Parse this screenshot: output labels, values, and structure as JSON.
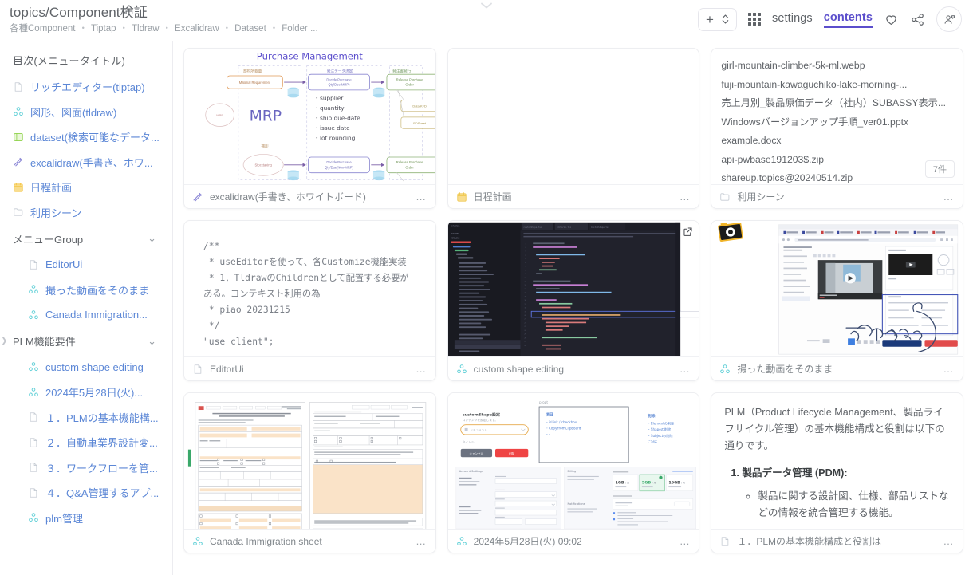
{
  "header": {
    "title": "topics/Component検証",
    "breadcrumb": [
      "各種Component",
      "Tiptap",
      "Tldraw",
      "Excalidraw",
      "Dataset",
      "Folder ..."
    ],
    "add_label": "+",
    "grid_icon": "grid-icon",
    "nav": [
      {
        "label": "settings",
        "active": false
      },
      {
        "label": "contents",
        "active": true
      }
    ],
    "favorite_icon": "heart-icon",
    "share_icon": "share-icon",
    "account_icon": "account-icon",
    "accent_color": "#5b4ecc"
  },
  "sidebar": {
    "title": "目次(メニュータイトル)",
    "items": [
      {
        "label": "リッチエディター(tiptap)",
        "icon": "document-icon",
        "icon_color": "#c5cbd3"
      },
      {
        "label": "図形、図面(tldraw)",
        "icon": "tldraw-icon",
        "icon_color": "#5ecfd6"
      },
      {
        "label": "dataset(検索可能なデータ...",
        "icon": "dataset-icon",
        "icon_color": "#8ed24a"
      },
      {
        "label": "excalidraw(手書き、ホワ...",
        "icon": "excalidraw-icon",
        "icon_color": "#8b87d6"
      },
      {
        "label": "日程計画",
        "icon": "calendar-icon",
        "icon_color": "#f5c84c"
      },
      {
        "label": "利用シーン",
        "icon": "folder-icon",
        "icon_color": "#c5cbd3"
      }
    ],
    "groups": [
      {
        "label": "メニューGroup",
        "expanded": true,
        "children": [
          {
            "label": "EditorUi",
            "icon": "document-icon",
            "icon_color": "#c5cbd3"
          },
          {
            "label": "撮った動画をそのまま",
            "icon": "tldraw-icon",
            "icon_color": "#5ecfd6"
          },
          {
            "label": "Canada Immigration...",
            "icon": "tldraw-icon",
            "icon_color": "#5ecfd6"
          }
        ]
      },
      {
        "label": "PLM機能要件",
        "expanded": true,
        "children": [
          {
            "label": "custom shape editing",
            "icon": "tldraw-icon",
            "icon_color": "#5ecfd6"
          },
          {
            "label": "2024年5月28日(火)...",
            "icon": "tldraw-icon",
            "icon_color": "#5ecfd6"
          },
          {
            "label": "１．PLMの基本機能構...",
            "icon": "document-icon",
            "icon_color": "#c5cbd3"
          },
          {
            "label": "２．自動車業界設計変...",
            "icon": "document-icon",
            "icon_color": "#c5cbd3"
          },
          {
            "label": "３．ワークフローを管...",
            "icon": "document-icon",
            "icon_color": "#c5cbd3"
          },
          {
            "label": "４．Q&A管理するアプ...",
            "icon": "document-icon",
            "icon_color": "#c5cbd3"
          },
          {
            "label": "plm管理",
            "icon": "tldraw-icon",
            "icon_color": "#5ecfd6"
          }
        ]
      }
    ]
  },
  "cards": [
    {
      "id": "excalidraw",
      "label": "excalidraw(手書き、ホワイトボード)",
      "icon": "excalidraw-icon",
      "icon_color": "#8b87d6",
      "menu": "…",
      "diagram": {
        "title": "Purchase Management",
        "lane_labels": [
          "部材所要量",
          "発注データ決定",
          "発注書発行"
        ],
        "nodes": [
          "Material Requirement",
          "Decide Purchase Qty/Due(MRP)",
          "Release Purchase Order",
          "Data-KFD",
          "PDSheet",
          "Stocktaking",
          "Decide Purchase Qty/Due(Non-MRP)",
          "Release Purchase Order"
        ],
        "big_label": "MRP",
        "small_label": "MRP",
        "second_label": "棚卸",
        "bullets": [
          "supplier",
          "quantity",
          "ship:due-date",
          "issue date",
          "lot rounding"
        ]
      }
    },
    {
      "id": "schedule",
      "label": "日程計画",
      "icon": "calendar-icon",
      "icon_color": "#f5c84c",
      "menu": "…"
    },
    {
      "id": "usecase",
      "label": "利用シーン",
      "icon": "folder-icon",
      "icon_color": "#c5cbd3",
      "menu": "…",
      "files": [
        "girl-mountain-climber-5k-ml.webp",
        "fuji-mountain-kawaguchiko-lake-morning-...",
        "売上月別_製品原価データ（社内）SUBASSY表示...",
        "Windowsバージョンアップ手順_ver01.pptx",
        "example.docx",
        "api-pwbase191203$.zip",
        "shareup.topics@20240514.zip"
      ],
      "count_badge": "7件"
    },
    {
      "id": "editorui",
      "label": "EditorUi",
      "icon": "document-icon",
      "icon_color": "#c5cbd3",
      "menu": "…",
      "code": "/**\n * useEditorを使って、各Customize機能実装\n * 1．TldrawのChildrenとして配置する必要がある。コンテキスト利用の為\n * piao 20231215\n */\n\"use client\";"
    },
    {
      "id": "customshape",
      "label": "custom shape editing",
      "icon": "tldraw-icon",
      "icon_color": "#5ecfd6",
      "menu": "…",
      "open_icon": "open-external-icon"
    },
    {
      "id": "video",
      "label": "撮った動画をそのまま",
      "icon": "tldraw-icon",
      "icon_color": "#5ecfd6",
      "menu": "…"
    },
    {
      "id": "canada",
      "label": "Canada Immigration sheet",
      "icon": "tldraw-icon",
      "icon_color": "#5ecfd6",
      "menu": "…"
    },
    {
      "id": "whiteboard",
      "label": "2024年5月28日(火) 09:02",
      "icon": "tldraw-icon",
      "icon_color": "#5ecfd6",
      "menu": "…",
      "notes": {
        "form_title": "customShape設定",
        "form_sub": "コンテンツを設定します。",
        "select_placeholder": "ドキュメント",
        "field_label": "タイトル",
        "btn_cancel": "キャンセル",
        "btn_ok": "削除",
        "prompt_caption": "propt",
        "list_title": "項目",
        "list_items": [
          "isLink / checkbox",
          "CopyFromClipboard",
          "-"
        ],
        "right_title": "削除",
        "right_items": [
          "Elementの削除",
          "Shapeの削除",
          "Subjectの削除",
          "に対応"
        ],
        "panel_a": "Account Settings",
        "panel_b": "Billing",
        "panel_c": "Notifications"
      }
    },
    {
      "id": "plm",
      "label": "１．PLMの基本機能構成と役割は",
      "icon": "document-icon",
      "icon_color": "#c5cbd3",
      "menu": "…",
      "text_intro": "PLM（Product Lifecycle Management、製品ライフサイクル管理）の基本機能構成と役割は以下の通りです。",
      "list_1": "製品データ管理 (PDM):",
      "list_1_sub": "製品に関する設計図、仕様、部品リストなどの情報を統合管理する機能。"
    }
  ]
}
